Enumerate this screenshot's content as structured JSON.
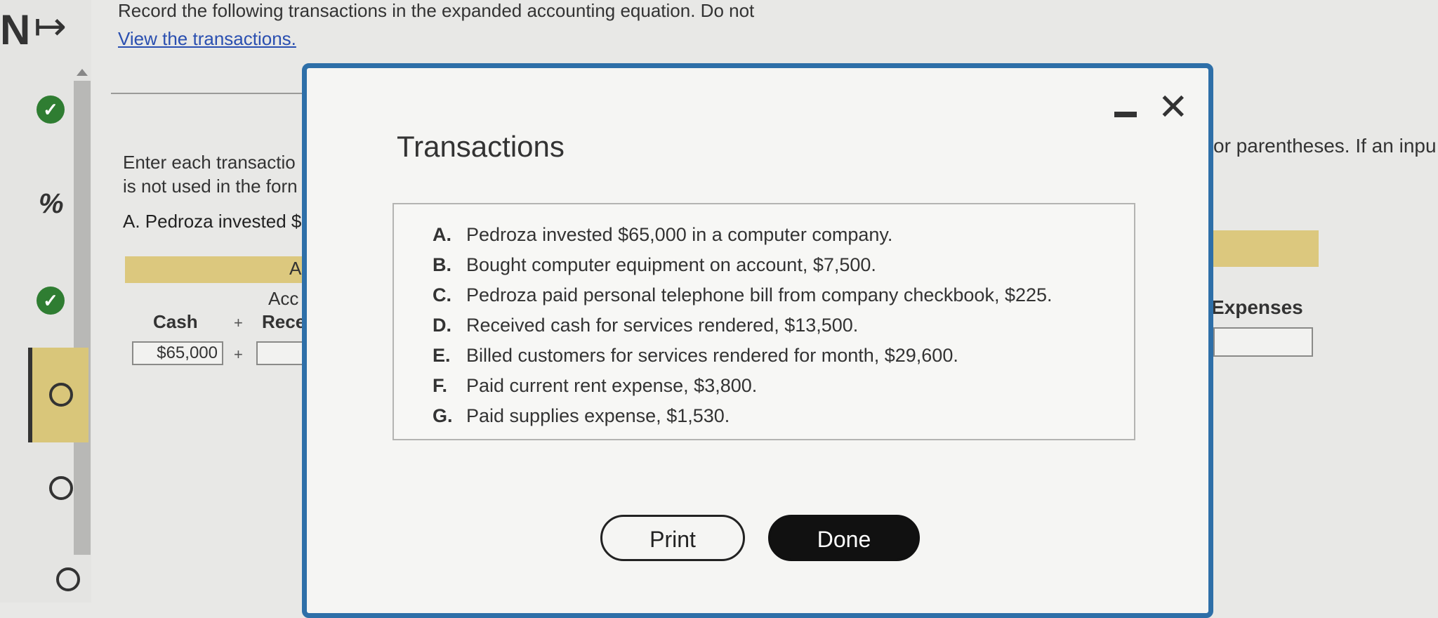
{
  "rail": {
    "logo": "N",
    "expand_icon": "↦",
    "percent_icon": "%"
  },
  "question": {
    "text": "Record the following transactions in the expanded accounting equation. Do not",
    "view_link": "View the transactions."
  },
  "instructions": {
    "line1": "Enter each transactio",
    "line2": "is not used in the forn",
    "line_a": "A. Pedroza invested $",
    "right": "or parentheses. If an inpu"
  },
  "equation": {
    "header_a": "A",
    "col_acc": "Acc",
    "col_rece": "Rece",
    "col_cash": "Cash",
    "plus": "+",
    "cash_value": "$65,000",
    "recv_value": "$",
    "expenses": "Expenses"
  },
  "modal": {
    "title": "Transactions",
    "minimize_icon": "minimize-icon",
    "close_icon": "close-icon",
    "transactions": [
      {
        "letter": "A.",
        "text": "Pedroza invested $65,000 in a computer company."
      },
      {
        "letter": "B.",
        "text": "Bought computer equipment on account, $7,500."
      },
      {
        "letter": "C.",
        "text": "Pedroza paid personal telephone bill from company checkbook, $225."
      },
      {
        "letter": "D.",
        "text": "Received cash for services rendered, $13,500."
      },
      {
        "letter": "E.",
        "text": "Billed customers for services rendered for month, $29,600."
      },
      {
        "letter": "F.",
        "text": "Paid current rent expense, $3,800."
      },
      {
        "letter": "G.",
        "text": "Paid supplies expense, $1,530."
      }
    ],
    "print_label": "Print",
    "done_label": "Done"
  },
  "colors": {
    "modal_border": "#2e6fa8",
    "status_complete": "#2f7d32",
    "active_highlight": "#d9c67a",
    "link": "#2a4fb0"
  }
}
